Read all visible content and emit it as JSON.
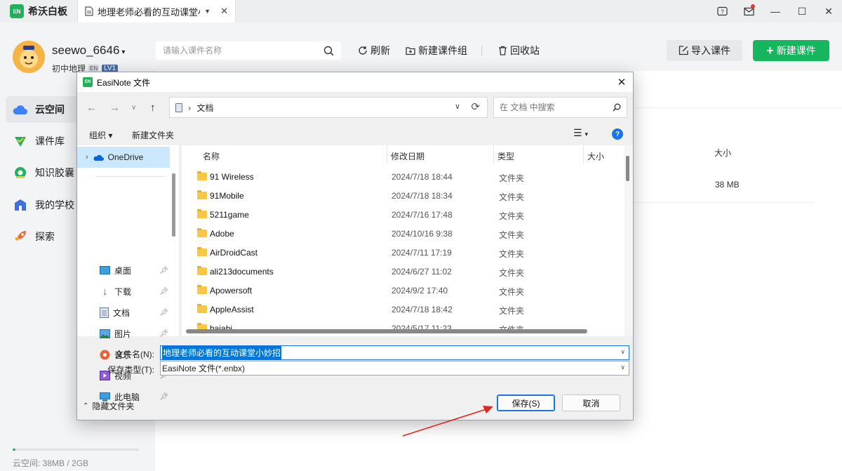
{
  "app": {
    "logo_text": "EN",
    "name": "希沃白板",
    "tab_title": "地理老师必看的互动课堂小...",
    "brand_color": "#16b65e"
  },
  "window_controls": [
    "help-icon",
    "mail-icon",
    "minimize-icon",
    "maximize-icon",
    "close-icon"
  ],
  "user": {
    "name": "seewo_6646",
    "subject": "初中地理",
    "level_tag": "EN",
    "level": "LV1"
  },
  "header": {
    "search_placeholder": "请输入课件名称",
    "refresh": "刷新",
    "new_group": "新建课件组",
    "recycle": "回收站",
    "import": "导入课件",
    "new_course": "新建课件"
  },
  "sidebar": {
    "items": [
      {
        "label": "云空间",
        "icon": "cloud-icon",
        "active": true
      },
      {
        "label": "课件库",
        "icon": "courseware-library-icon",
        "active": false
      },
      {
        "label": "知识胶囊",
        "icon": "knowledge-capsule-icon",
        "active": false
      },
      {
        "label": "我的学校",
        "icon": "school-icon",
        "active": false
      },
      {
        "label": "探索",
        "icon": "rocket-icon",
        "active": false
      }
    ],
    "storage_text": "云空间:   38MB / 2GB",
    "storage_fraction": 0.019
  },
  "main": {
    "size_header": "大小",
    "size_value": "38 MB"
  },
  "dialog": {
    "title": "EasiNote 文件",
    "logo_text": "EN",
    "address_current": "文档",
    "search_placeholder": "在 文档 中搜索",
    "toolbar": {
      "organize": "组织 ▾",
      "new_folder": "新建文件夹"
    },
    "nav_items": [
      {
        "label": "OneDrive",
        "icon": "onedrive-icon",
        "pinned": false,
        "selected": true
      },
      {
        "label": "桌面",
        "icon": "desktop-icon",
        "pinned": true
      },
      {
        "label": "下载",
        "icon": "download-icon",
        "pinned": true
      },
      {
        "label": "文档",
        "icon": "documents-icon",
        "pinned": true
      },
      {
        "label": "图片",
        "icon": "pictures-icon",
        "pinned": true
      },
      {
        "label": "音乐",
        "icon": "music-icon",
        "pinned": true
      },
      {
        "label": "视频",
        "icon": "videos-icon",
        "pinned": true
      },
      {
        "label": "此电脑",
        "icon": "this-pc-icon",
        "pinned": true
      }
    ],
    "columns": {
      "name": "名称",
      "date": "修改日期",
      "type": "类型",
      "size": "大小"
    },
    "files": [
      {
        "name": "91 Wireless",
        "date": "2024/7/18 18:44",
        "type": "文件夹"
      },
      {
        "name": "91Mobile",
        "date": "2024/7/18 18:34",
        "type": "文件夹"
      },
      {
        "name": "5211game",
        "date": "2024/7/16 17:48",
        "type": "文件夹"
      },
      {
        "name": "Adobe",
        "date": "2024/10/16 9:38",
        "type": "文件夹"
      },
      {
        "name": "AirDroidCast",
        "date": "2024/7/11 17:19",
        "type": "文件夹"
      },
      {
        "name": "ali213documents",
        "date": "2024/6/27 11:02",
        "type": "文件夹"
      },
      {
        "name": "Apowersoft",
        "date": "2024/9/2 17:40",
        "type": "文件夹"
      },
      {
        "name": "AppleAssist",
        "date": "2024/7/18 18:42",
        "type": "文件夹"
      },
      {
        "name": "baiabi",
        "date": "2024/5/17 11:23",
        "type": "文件夹"
      }
    ],
    "filename_label": "文件名(N):",
    "filename_value": "地理老师必看的互动课堂小妙招",
    "filetype_label": "保存类型(T):",
    "filetype_value": "EasiNote 文件(*.enbx)",
    "hide_folders": "隐藏文件夹",
    "save": "保存(S)",
    "cancel": "取消"
  },
  "annotation": {
    "arrow_color": "#e0281e"
  }
}
